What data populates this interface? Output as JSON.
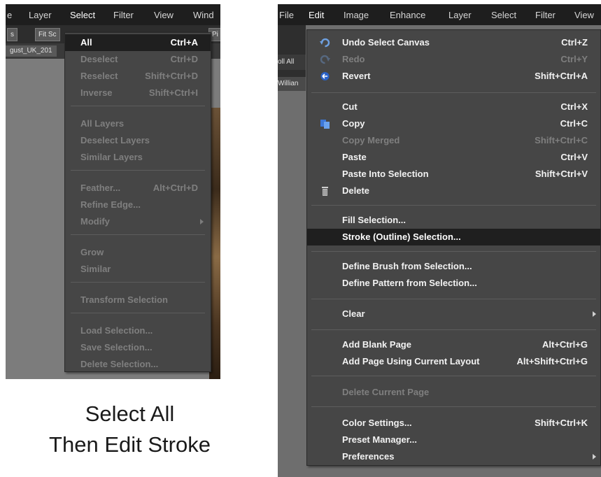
{
  "left": {
    "menubar": [
      "e",
      "Layer",
      "Select",
      "Filter",
      "View",
      "Wind"
    ],
    "toolbar": [
      "s",
      "Fit Sc",
      "",
      "",
      "",
      "",
      "",
      "",
      "Pi"
    ],
    "doc_tab": "gust_UK_201",
    "select_menu": {
      "items": [
        {
          "label": "All",
          "shortcut": "Ctrl+A",
          "state": "highlighted"
        },
        {
          "label": "Deselect",
          "shortcut": "Ctrl+D",
          "state": "disabled"
        },
        {
          "label": "Reselect",
          "shortcut": "Shift+Ctrl+D",
          "state": "disabled"
        },
        {
          "label": "Inverse",
          "shortcut": "Shift+Ctrl+I",
          "state": "disabled"
        },
        {
          "label": "All Layers",
          "shortcut": "",
          "state": "disabled"
        },
        {
          "label": "Deselect Layers",
          "shortcut": "",
          "state": "disabled"
        },
        {
          "label": "Similar Layers",
          "shortcut": "",
          "state": "disabled"
        },
        {
          "label": "Feather...",
          "shortcut": "Alt+Ctrl+D",
          "state": "disabled"
        },
        {
          "label": "Refine Edge...",
          "shortcut": "",
          "state": "disabled"
        },
        {
          "label": "Modify",
          "shortcut": "",
          "state": "disabled",
          "submenu": true
        },
        {
          "label": "Grow",
          "shortcut": "",
          "state": "disabled"
        },
        {
          "label": "Similar",
          "shortcut": "",
          "state": "disabled"
        },
        {
          "label": "Transform Selection",
          "shortcut": "",
          "state": "disabled"
        },
        {
          "label": "Load Selection...",
          "shortcut": "",
          "state": "disabled"
        },
        {
          "label": "Save Selection...",
          "shortcut": "",
          "state": "disabled"
        },
        {
          "label": "Delete Selection...",
          "shortcut": "",
          "state": "disabled"
        }
      ]
    }
  },
  "caption": {
    "line1": "Select All",
    "line2": "Then Edit Stroke"
  },
  "right": {
    "menubar": [
      "File",
      "Edit",
      "Image",
      "Enhance",
      "Layer",
      "Select",
      "Filter",
      "View"
    ],
    "side_tab_a": "oll All",
    "side_tab_b": "Willian",
    "edit_menu": {
      "items": [
        {
          "label": "Undo Select Canvas",
          "shortcut": "Ctrl+Z",
          "state": "enabled",
          "icon": "undo-icon"
        },
        {
          "label": "Redo",
          "shortcut": "Ctrl+Y",
          "state": "disabled",
          "icon": "redo-icon"
        },
        {
          "label": "Revert",
          "shortcut": "Shift+Ctrl+A",
          "state": "enabled",
          "icon": "revert-icon"
        },
        {
          "label": "Cut",
          "shortcut": "Ctrl+X",
          "state": "enabled",
          "icon": ""
        },
        {
          "label": "Copy",
          "shortcut": "Ctrl+C",
          "state": "enabled",
          "icon": "copy-icon"
        },
        {
          "label": "Copy Merged",
          "shortcut": "Shift+Ctrl+C",
          "state": "disabled",
          "icon": ""
        },
        {
          "label": "Paste",
          "shortcut": "Ctrl+V",
          "state": "enabled",
          "icon": ""
        },
        {
          "label": "Paste Into Selection",
          "shortcut": "Shift+Ctrl+V",
          "state": "enabled",
          "icon": ""
        },
        {
          "label": "Delete",
          "shortcut": "",
          "state": "enabled",
          "icon": "trash-icon"
        },
        {
          "label": "Fill Selection...",
          "shortcut": "",
          "state": "enabled",
          "icon": ""
        },
        {
          "label": "Stroke (Outline) Selection...",
          "shortcut": "",
          "state": "highlighted",
          "icon": ""
        },
        {
          "label": "Define Brush from Selection...",
          "shortcut": "",
          "state": "enabled",
          "icon": ""
        },
        {
          "label": "Define Pattern from Selection...",
          "shortcut": "",
          "state": "enabled",
          "icon": ""
        },
        {
          "label": "Clear",
          "shortcut": "",
          "state": "enabled",
          "submenu": true,
          "icon": ""
        },
        {
          "label": "Add Blank Page",
          "shortcut": "Alt+Ctrl+G",
          "state": "enabled",
          "icon": ""
        },
        {
          "label": "Add Page Using Current Layout",
          "shortcut": "Alt+Shift+Ctrl+G",
          "state": "enabled",
          "icon": ""
        },
        {
          "label": "Delete Current Page",
          "shortcut": "",
          "state": "disabled",
          "icon": ""
        },
        {
          "label": "Color Settings...",
          "shortcut": "Shift+Ctrl+K",
          "state": "enabled",
          "icon": ""
        },
        {
          "label": "Preset Manager...",
          "shortcut": "",
          "state": "enabled",
          "icon": ""
        },
        {
          "label": "Preferences",
          "shortcut": "",
          "state": "enabled",
          "submenu": true,
          "icon": ""
        }
      ]
    }
  }
}
